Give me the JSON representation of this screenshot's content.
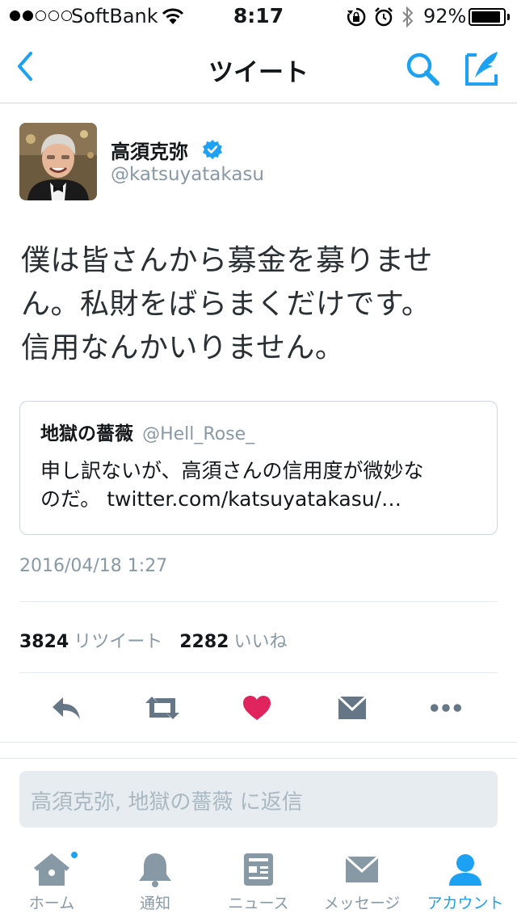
{
  "status_bar": {
    "carrier": "SoftBank",
    "time": "8:17",
    "battery": "92%",
    "battery_level": 0.92
  },
  "nav": {
    "title": "ツイート",
    "back_icon": "chevron-left-icon",
    "search_icon": "search-icon",
    "compose_icon": "compose-icon"
  },
  "tweet": {
    "author_name": "高須克弥",
    "handle": "@katsuyatakasu",
    "text_lines": [
      "僕は皆さんから募金を募りませ",
      "ん。私財をばらまくだけです。",
      "信用なんかいりません。"
    ],
    "timestamp": "2016/04/18 1:27",
    "retweet_count": "3824",
    "retweet_label": "リツイート",
    "like_count": "2282",
    "like_label": "いいね"
  },
  "quoted_tweet": {
    "author_name": "地獄の薔薇",
    "handle": "@Hell_Rose_",
    "text_lines": [
      "申し訳ないが、高須さんの信用度が微妙な",
      "のだ。 twitter.com/katsuyatakasu/…"
    ]
  },
  "actions": [
    "reply-icon",
    "retweet-icon",
    "like-icon",
    "dm-icon",
    "more-icon"
  ],
  "reply": {
    "placeholder": "高須克弥, 地獄の薔薇 に返信"
  },
  "tab_bar": {
    "tabs": [
      {
        "label": "ホーム",
        "icon": "home-icon"
      },
      {
        "label": "通知",
        "icon": "bell-icon"
      },
      {
        "label": "ニュース",
        "icon": "news-icon"
      },
      {
        "label": "メッセージ",
        "icon": "envelope-icon"
      },
      {
        "label": "アカウント",
        "icon": "person-icon"
      }
    ],
    "active": "アカウント"
  },
  "colors": {
    "accent": "#1da1f2",
    "like": "#e0245e",
    "muted": "#8899a6",
    "icon_gray": "#657786"
  }
}
